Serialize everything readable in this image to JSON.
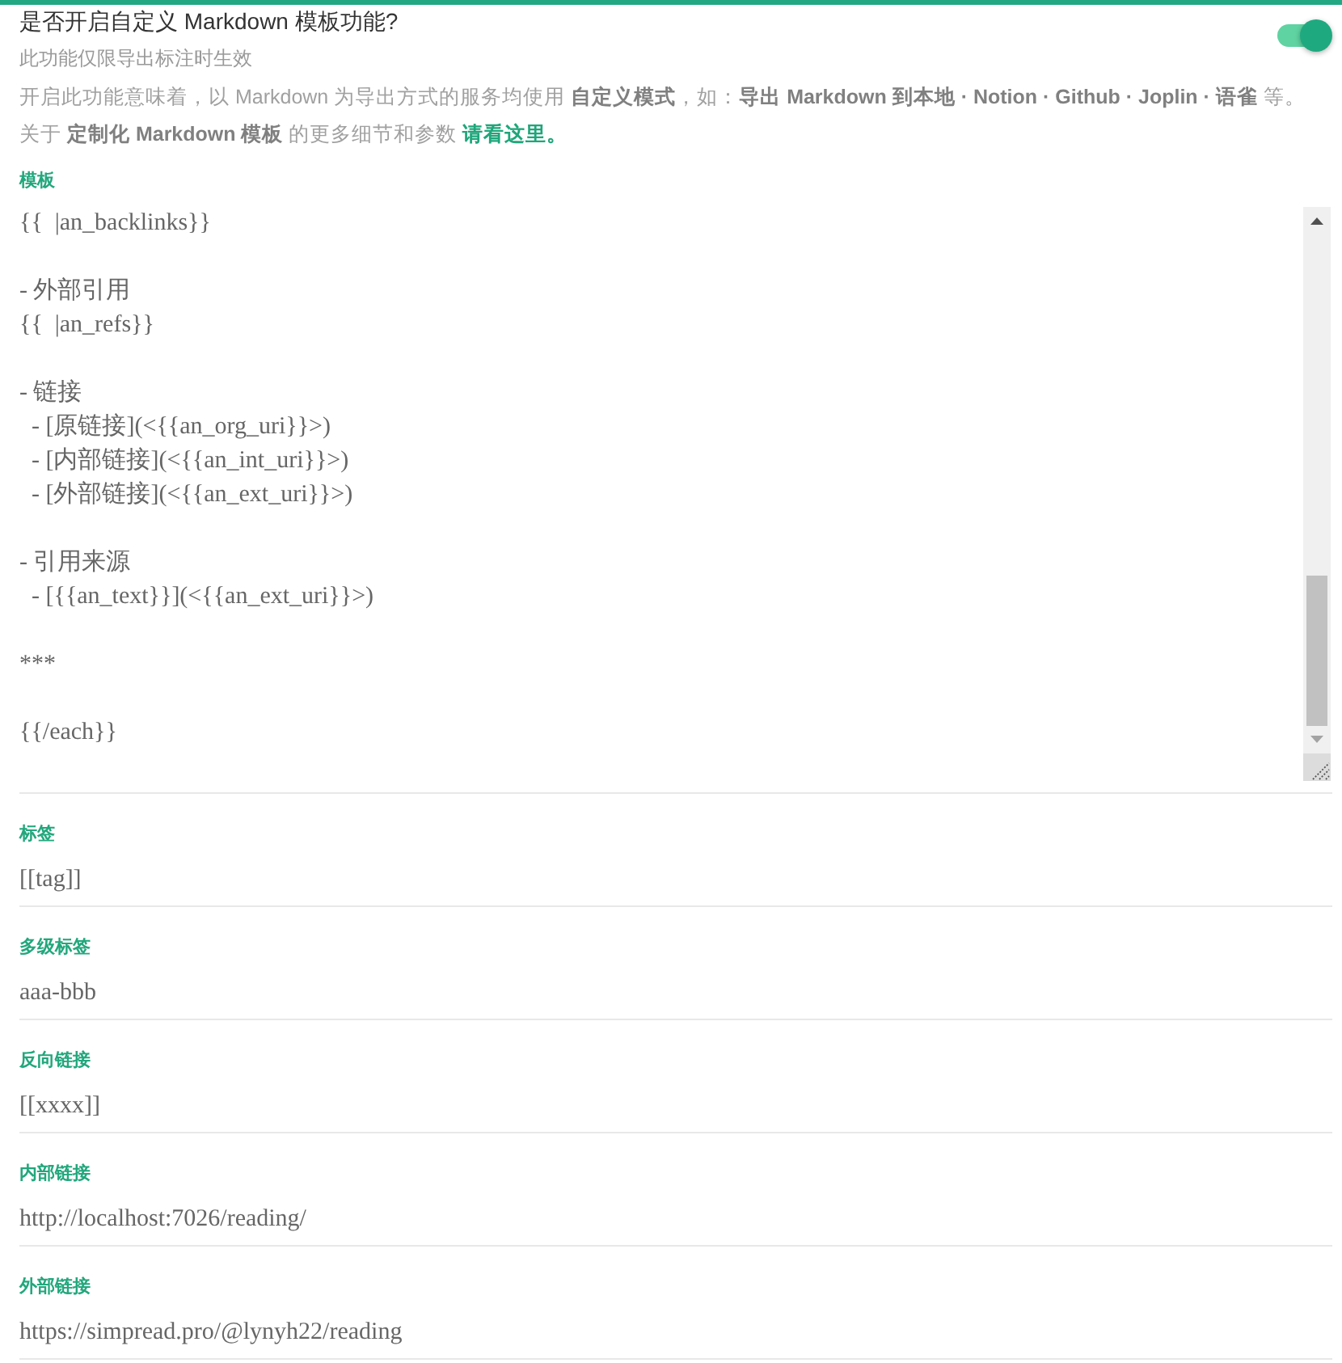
{
  "setting": {
    "title": "是否开启自定义 Markdown 模板功能?",
    "hint": "此功能仅限导出标注时生效",
    "toggle": {
      "on": true
    },
    "description": "开启此功能意味着，以 Markdown 为导出方式的服务均使用 **自定义模式**，如：**导出 Markdown 到本地 · Notion · Github · Joplin · 语雀** 等。",
    "more": {
      "text": "关于 **定制化 Markdown 模板** 的更多细节和参数",
      "link": "请看这里。"
    }
  },
  "template": {
    "label": "模板",
    "value": "{{  |an_backlinks}}\n\n- 外部引用\n{{  |an_refs}}\n\n- 链接\n  - [原链接](<{{an_org_uri}}>)\n  - [内部链接](<{{an_int_uri}}>)\n  - [外部链接](<{{an_ext_uri}}>)\n\n- 引用来源\n  - [{{an_text}}](<{{an_ext_uri}}>)\n\n***\n\n{{/each}}"
  },
  "fields": [
    {
      "label": "标签",
      "value": "[[tag]]"
    },
    {
      "label": "多级标签",
      "value": "aaa-bbb"
    },
    {
      "label": "反向链接",
      "value": "[[xxxx]]"
    },
    {
      "label": "内部链接",
      "value": "http://localhost:7026/reading/"
    },
    {
      "label": "外部链接",
      "value": "https://simpread.pro/@lynyh22/reading"
    }
  ]
}
